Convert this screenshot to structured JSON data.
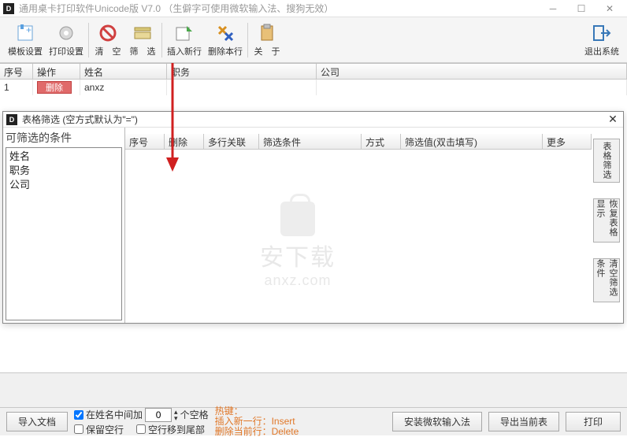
{
  "main_title": "通用桌卡打印软件Unicode版   V7.0  （生僻字可使用微软输入法、搜狗无效）",
  "toolbar": {
    "template_settings": "模板设置",
    "print_settings": "打印设置",
    "clear": "清　空",
    "filter": "筛　选",
    "insert_row": "插入新行",
    "delete_row": "删除本行",
    "about": "关　于",
    "exit": "退出系统"
  },
  "main_table": {
    "headers": {
      "seq": "序号",
      "op": "操作",
      "name": "姓名",
      "title": "职务",
      "company": "公司"
    },
    "rows": [
      {
        "seq": "1",
        "op": "删除",
        "name": "anxz",
        "title": "",
        "company": ""
      }
    ]
  },
  "filter_dialog": {
    "title": "表格筛选  (空方式默认为\"=\")",
    "left_caption": "可筛选的条件",
    "left_items": [
      "姓名",
      "职务",
      "公司"
    ],
    "grid_headers": {
      "seq": "序号",
      "del": "删除",
      "multi": "多行关联",
      "cond": "筛选条件",
      "mode": "方式",
      "value": "筛选值(双击填写)",
      "more": "更多"
    },
    "right_buttons": {
      "filter": "表格筛选",
      "restore": "恢复表格显示",
      "clear": "清空筛选条件"
    }
  },
  "footer": {
    "import": "导入文档",
    "chk_insert_mid": "在姓名中间加",
    "spin_value": "0",
    "spaces_suffix": "个空格",
    "chk_keep_blank": "保留空行",
    "chk_blank_tail": "空行移到尾部",
    "hotkey_title": "热键：",
    "hotkey_insert": "插入新一行：Insert",
    "hotkey_delete": "删除当前行：Delete",
    "install_ime": "安装微软输入法",
    "export_table": "导出当前表",
    "print": "打印"
  },
  "watermark": {
    "cn": "安下载",
    "en": "anxz.com"
  }
}
